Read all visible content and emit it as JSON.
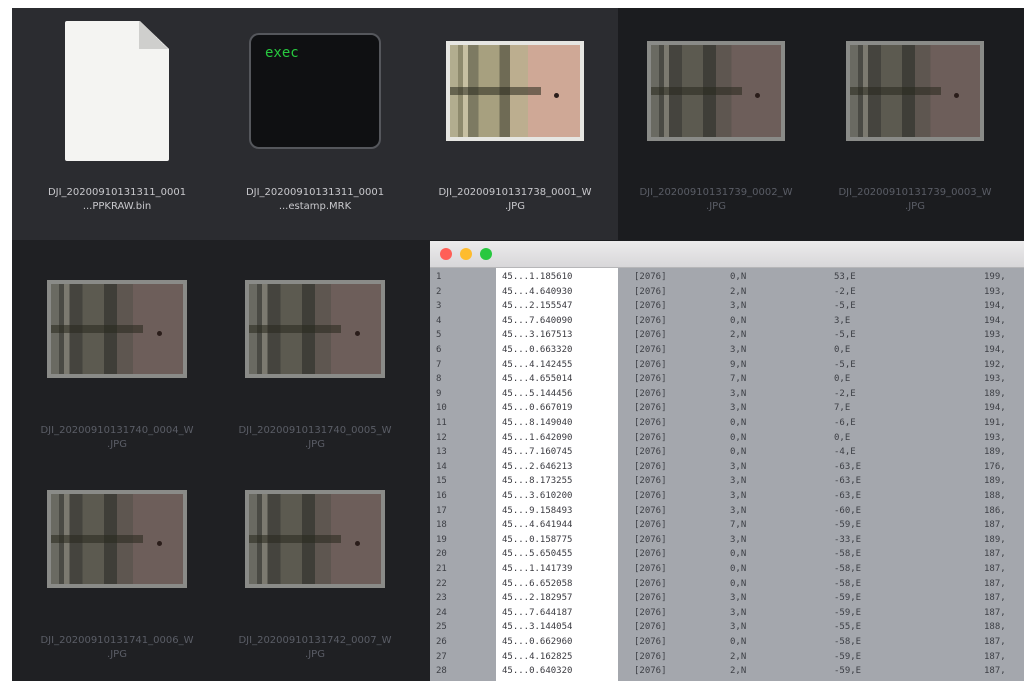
{
  "finder": {
    "files": [
      {
        "label_line1": "DJI_20200910131311_0001",
        "label_line2": "...PPKRAW.bin",
        "type": "document",
        "icon": "document-icon",
        "dimmed": false
      },
      {
        "label_line1": "DJI_20200910131311_0001",
        "label_line2": "...estamp.MRK",
        "type": "exec",
        "icon": "exec-icon",
        "dimmed": false
      },
      {
        "label_line1": "DJI_20200910131738_0001_W",
        "label_line2": ".JPG",
        "type": "photo",
        "icon": "photo-thumbnail-icon",
        "dimmed": false
      },
      {
        "label_line1": "DJI_20200910131739_0002_W",
        "label_line2": ".JPG",
        "type": "photo",
        "icon": "photo-thumbnail-icon",
        "dimmed": true
      },
      {
        "label_line1": "DJI_20200910131739_0003_W",
        "label_line2": ".JPG",
        "type": "photo",
        "icon": "photo-thumbnail-icon",
        "dimmed": true
      },
      {
        "label_line1": "DJI_20200910131740_0004_W",
        "label_line2": ".JPG",
        "type": "photo",
        "icon": "photo-thumbnail-icon",
        "dimmed": true
      },
      {
        "label_line1": "DJI_20200910131740_0005_W",
        "label_line2": ".JPG",
        "type": "photo",
        "icon": "photo-thumbnail-icon",
        "dimmed": true
      },
      {
        "label_line1": "DJI_20200910131741_0006_W",
        "label_line2": ".JPG",
        "type": "photo",
        "icon": "photo-thumbnail-icon",
        "dimmed": true
      },
      {
        "label_line1": "DJI_20200910131742_0007_W",
        "label_line2": ".JPG",
        "type": "photo",
        "icon": "photo-thumbnail-icon",
        "dimmed": true
      }
    ],
    "exec_text": "exec"
  },
  "terminal": {
    "rows": [
      [
        "1",
        "45...1.185610",
        "[2076]",
        "0,N",
        "53,E",
        "199,"
      ],
      [
        "2",
        "45...4.640930",
        "[2076]",
        "2,N",
        "-2,E",
        "193,"
      ],
      [
        "3",
        "45...2.155547",
        "[2076]",
        "3,N",
        "-5,E",
        "194,"
      ],
      [
        "4",
        "45...7.640090",
        "[2076]",
        "0,N",
        "3,E",
        "194,"
      ],
      [
        "5",
        "45...3.167513",
        "[2076]",
        "2,N",
        "-5,E",
        "193,"
      ],
      [
        "6",
        "45...0.663320",
        "[2076]",
        "3,N",
        "0,E",
        "194,"
      ],
      [
        "7",
        "45...4.142455",
        "[2076]",
        "9,N",
        "-5,E",
        "192,"
      ],
      [
        "8",
        "45...4.655014",
        "[2076]",
        "7,N",
        "0,E",
        "193,"
      ],
      [
        "9",
        "45...5.144456",
        "[2076]",
        "3,N",
        "-2,E",
        "189,"
      ],
      [
        "10",
        "45...0.667019",
        "[2076]",
        "3,N",
        "7,E",
        "194,"
      ],
      [
        "11",
        "45...8.149040",
        "[2076]",
        "0,N",
        "-6,E",
        "191,"
      ],
      [
        "12",
        "45...1.642090",
        "[2076]",
        "0,N",
        "0,E",
        "193,"
      ],
      [
        "13",
        "45...7.160745",
        "[2076]",
        "0,N",
        "-4,E",
        "189,"
      ],
      [
        "14",
        "45...2.646213",
        "[2076]",
        "3,N",
        "-63,E",
        "176,"
      ],
      [
        "15",
        "45...8.173255",
        "[2076]",
        "3,N",
        "-63,E",
        "189,"
      ],
      [
        "16",
        "45...3.610200",
        "[2076]",
        "3,N",
        "-63,E",
        "188,"
      ],
      [
        "17",
        "45...9.158493",
        "[2076]",
        "3,N",
        "-60,E",
        "186,"
      ],
      [
        "18",
        "45...4.641944",
        "[2076]",
        "7,N",
        "-59,E",
        "187,"
      ],
      [
        "19",
        "45...0.158775",
        "[2076]",
        "3,N",
        "-33,E",
        "189,"
      ],
      [
        "20",
        "45...5.650455",
        "[2076]",
        "0,N",
        "-58,E",
        "187,"
      ],
      [
        "21",
        "45...1.141739",
        "[2076]",
        "0,N",
        "-58,E",
        "187,"
      ],
      [
        "22",
        "45...6.652058",
        "[2076]",
        "0,N",
        "-58,E",
        "187,"
      ],
      [
        "23",
        "45...2.182957",
        "[2076]",
        "3,N",
        "-59,E",
        "187,"
      ],
      [
        "24",
        "45...7.644187",
        "[2076]",
        "3,N",
        "-59,E",
        "187,"
      ],
      [
        "25",
        "45...3.144054",
        "[2076]",
        "3,N",
        "-55,E",
        "188,"
      ],
      [
        "26",
        "45...0.662960",
        "[2076]",
        "0,N",
        "-58,E",
        "187,"
      ],
      [
        "27",
        "45...4.162825",
        "[2076]",
        "2,N",
        "-59,E",
        "187,"
      ],
      [
        "28",
        "45...0.640320",
        "[2076]",
        "2,N",
        "-59,E",
        "187,"
      ]
    ]
  },
  "colors": {
    "window_bg": "#1b1c1f",
    "selected_row_bg": "#2b2c30",
    "terminal_bg": "#a4a7ad",
    "close": "#ff5f57",
    "minimize": "#febc2e",
    "zoom": "#28c840",
    "exec_green": "#27c93f"
  }
}
